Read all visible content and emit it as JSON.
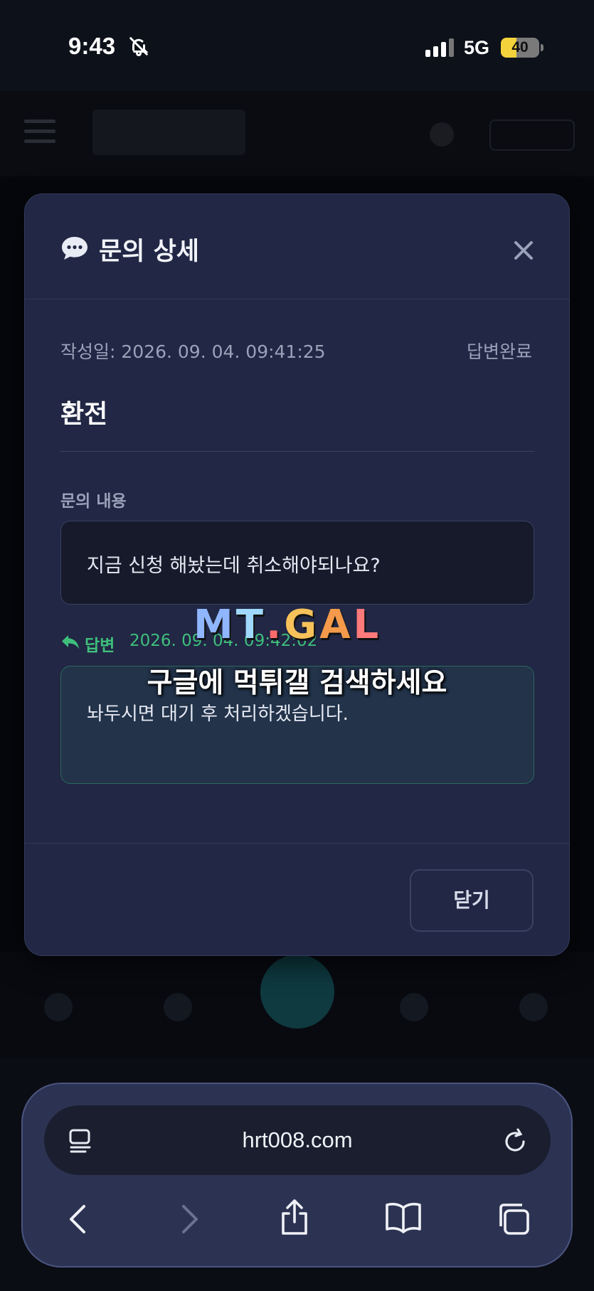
{
  "status_bar": {
    "time": "9:43",
    "network": "5G",
    "battery_percent": "40",
    "battery_level": 0.4
  },
  "modal": {
    "title": "문의 상세",
    "created_label": "작성일: 2026. 09. 04. 09:41:25",
    "status": "답변완료",
    "inquiry_title": "환전",
    "content_label": "문의 내용",
    "content_text": "지금 신청 해놨는데 취소해야되나요?",
    "reply_label": "답변",
    "reply_date": "2026. 09. 04. 09:42:02",
    "reply_text": "놔두시면 대기 후 처리하겠습니다.",
    "close_button": "닫기"
  },
  "watermark": {
    "logo_letters": [
      "M",
      "T",
      ".",
      "G",
      "A",
      "L"
    ],
    "logo_colors": [
      "#8fb6ff",
      "#9fd9ff",
      "#ff6b6b",
      "#f7c25a",
      "#f49a4a",
      "#ff7a7a"
    ],
    "tagline": "구글에 먹튀갤 검색하세요"
  },
  "browser": {
    "url": "hrt008.com"
  },
  "colors": {
    "accent_green": "#3fbf7c",
    "modal_bg": "#212744",
    "page_bg": "#0b0d14"
  }
}
